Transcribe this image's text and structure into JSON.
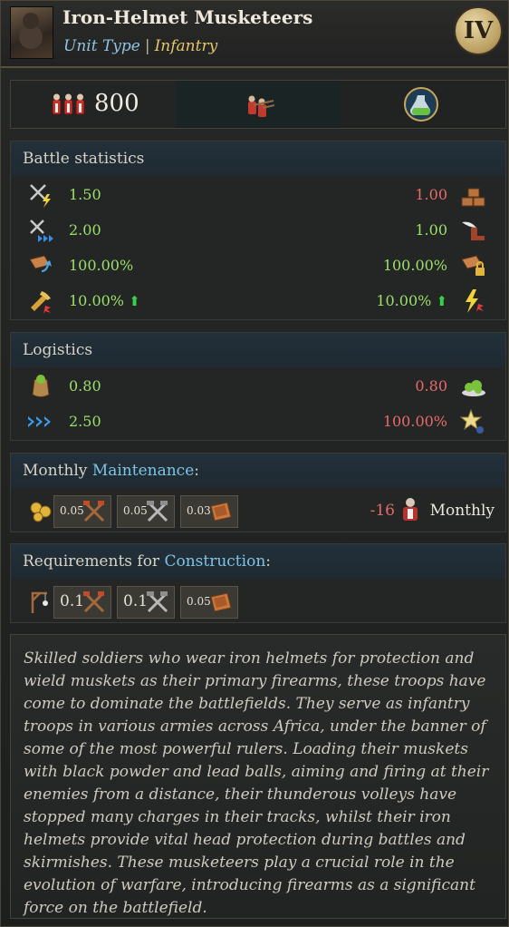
{
  "header": {
    "title": "Iron-Helmet Musketeers",
    "unit_type_key": "Unit Type",
    "separator": "|",
    "unit_type_value": "Infantry",
    "tier": "IV"
  },
  "topbar": {
    "soldiers_count": "800",
    "icons": [
      "soldiers-icon",
      "musketeer-icon",
      "potion-icon"
    ]
  },
  "battle": {
    "title": "Battle statistics",
    "rows": [
      {
        "left_icon": "attack-speed-icon",
        "left": "1.50",
        "right": "1.00",
        "right_icon": "defense-blocks-icon"
      },
      {
        "left_icon": "attack-range-icon",
        "left": "2.00",
        "right": "1.00",
        "right_icon": "winged-boot-icon"
      },
      {
        "left_icon": "charge-icon",
        "left": "100.00%",
        "right": "100.00%",
        "right_icon": "armor-lock-icon"
      },
      {
        "left_icon": "critical-icon",
        "left": "10.00%",
        "right": "10.00%",
        "right_icon": "lightning-icon"
      }
    ]
  },
  "logistics": {
    "title": "Logistics",
    "rows": [
      {
        "left_icon": "supply-sack-icon",
        "left": "0.80",
        "right": "0.80",
        "right_icon": "food-icon"
      },
      {
        "left_icon": "speed-chevrons-icon",
        "left": "2.50",
        "right": "100.00%",
        "right_icon": "morale-star-icon"
      }
    ]
  },
  "maintenance": {
    "title_prefix": "Monthly ",
    "title_highlight": "Maintenance",
    "title_suffix": ":",
    "costs": [
      {
        "amount": "0.05",
        "icon": "wood-axes-icon"
      },
      {
        "amount": "0.05",
        "icon": "iron-tools-icon"
      },
      {
        "amount": "0.03",
        "icon": "leather-icon"
      }
    ],
    "upkeep": "-16",
    "upkeep_label": "Monthly"
  },
  "construction": {
    "title_prefix": "Requirements for ",
    "title_highlight": "Construction",
    "title_suffix": ":",
    "costs": [
      {
        "amount": "0.1",
        "icon": "wood-axes-icon"
      },
      {
        "amount": "0.1",
        "icon": "iron-tools-icon"
      },
      {
        "amount": "0.05",
        "icon": "leather-icon"
      }
    ]
  },
  "description": "Skilled soldiers who wear iron helmets for protection and wield muskets as their primary firearms, these troops have come to dominate the battlefields. They serve as infantry troops in various armies across Africa, under the banner of some of the most powerful rulers. Loading their muskets with black powder and lead balls, aiming and firing at their enemies from a distance, their thunderous volleys have stopped many charges in their tracks, whilst their iron helmets provide vital head protection during battles and skirmishes. These musketeers play a crucial role in the evolution of warfare, introducing firearms as a significant force on the battlefield.",
  "colors": {
    "positive": "#9be06a",
    "negative": "#e86a6a",
    "highlight": "#7fc3e6",
    "gold": "#e6c66b"
  }
}
